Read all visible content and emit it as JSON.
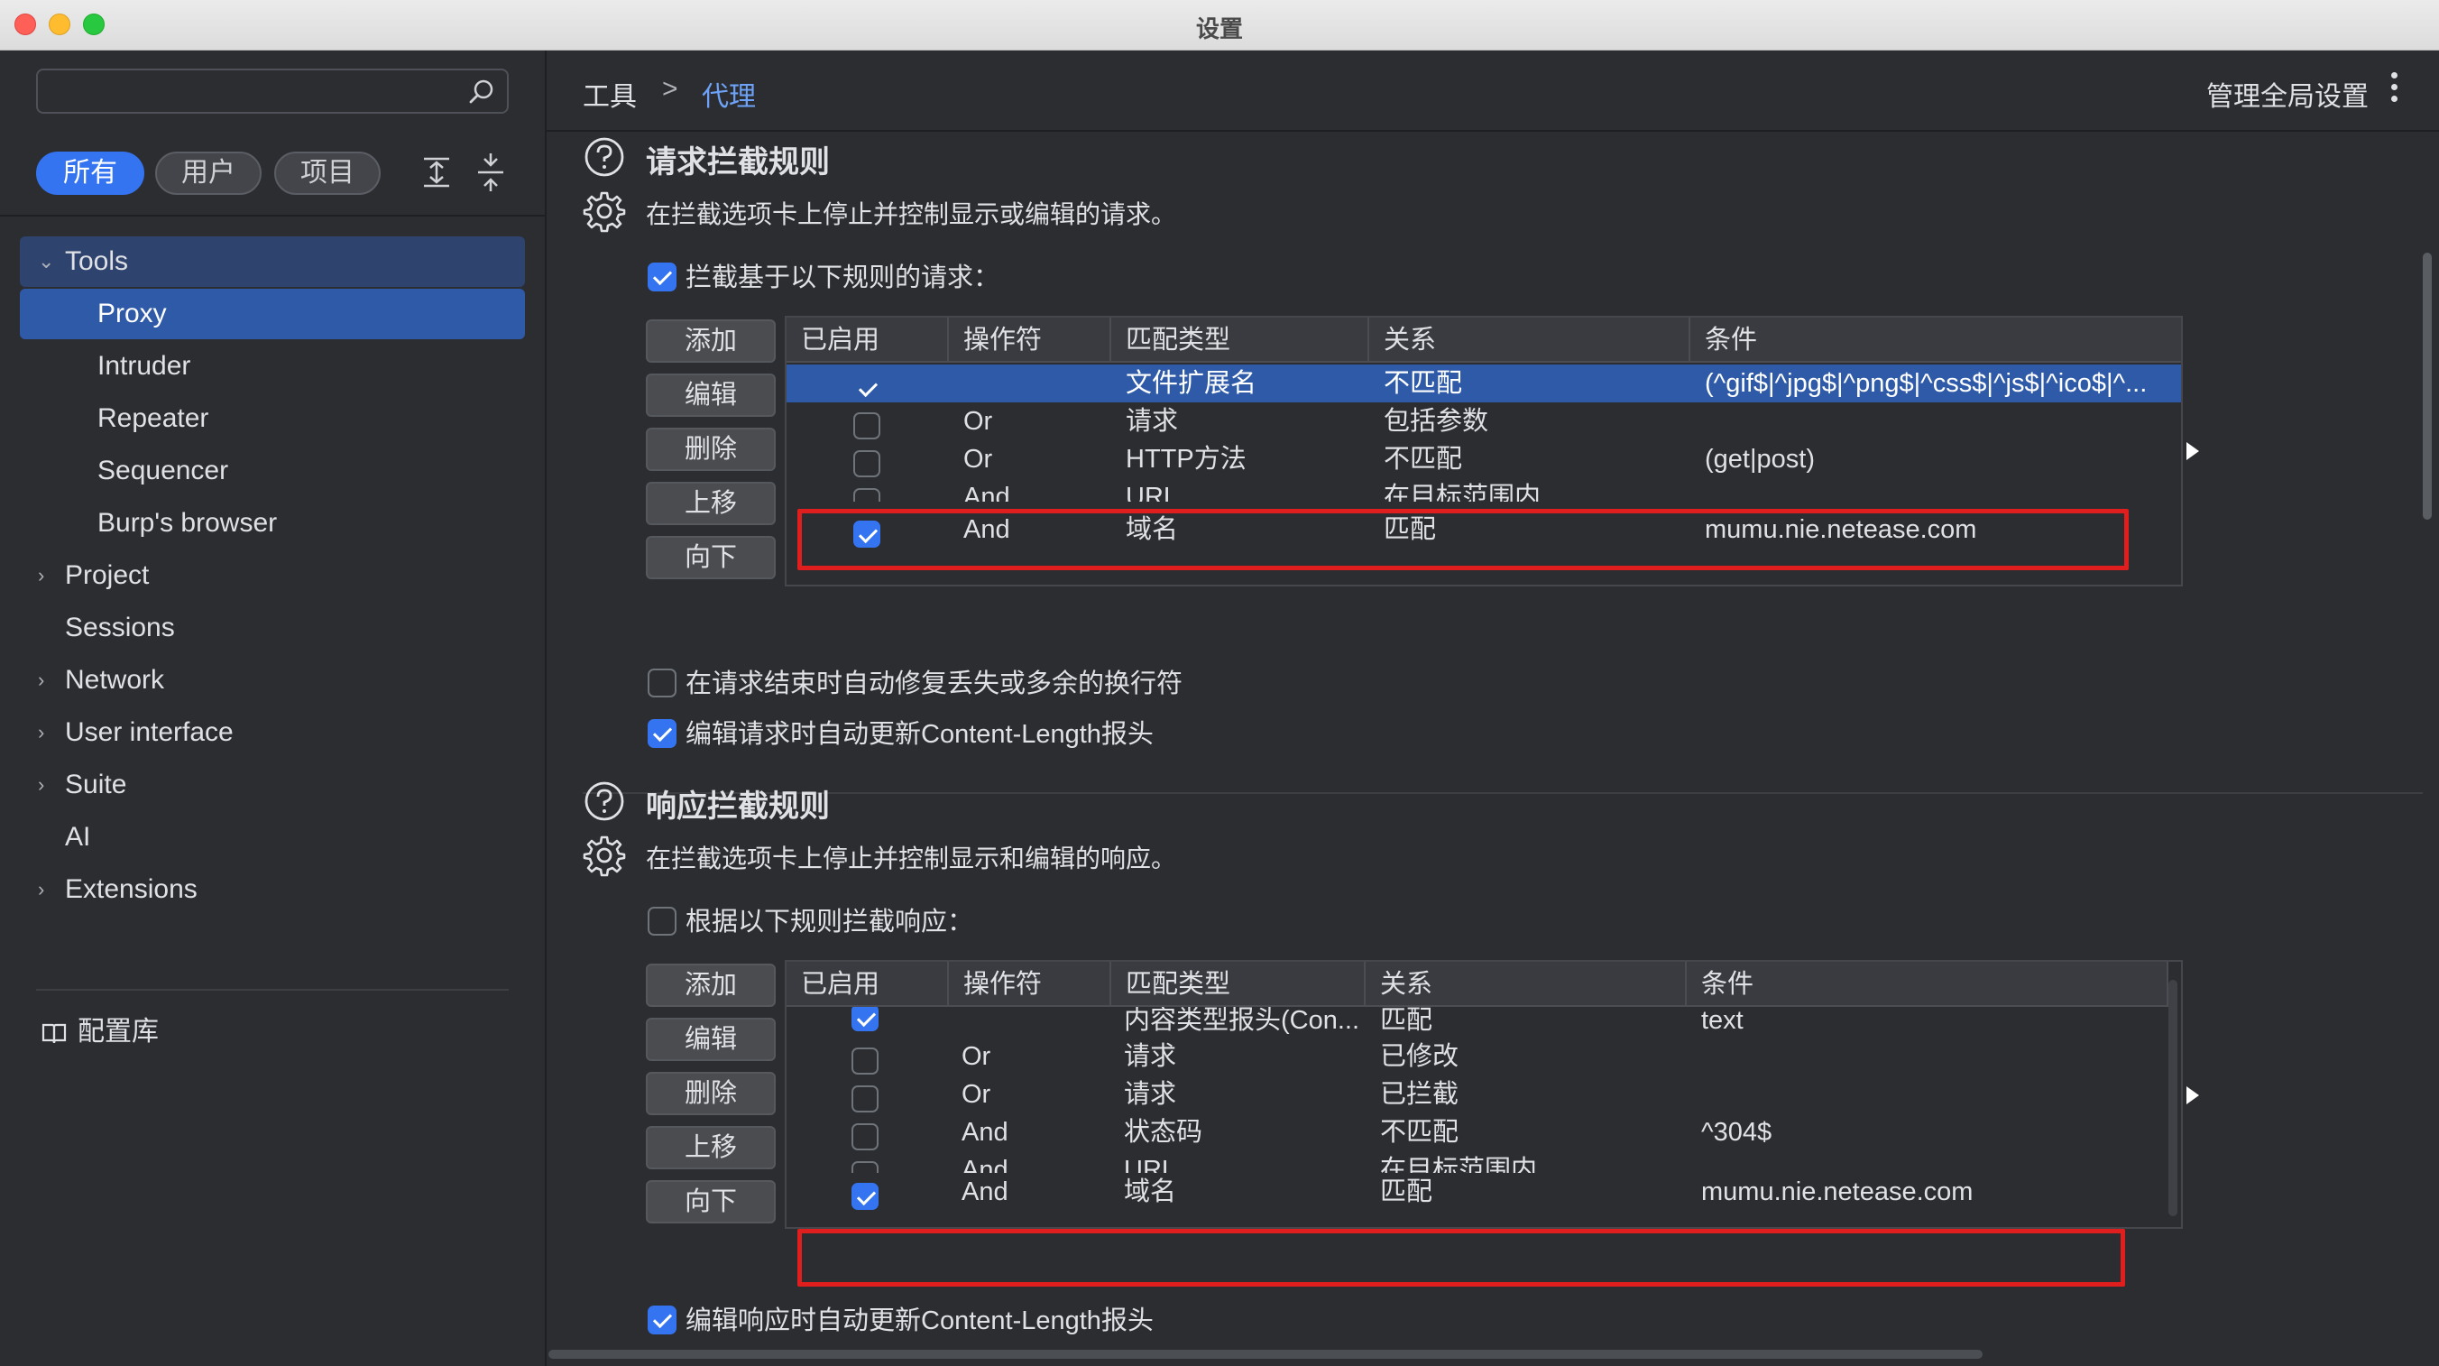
{
  "window": {
    "title": "设置"
  },
  "sidebar": {
    "search": {
      "placeholder": ""
    },
    "filters": [
      {
        "label": "所有",
        "active": true
      },
      {
        "label": "用户",
        "active": false
      },
      {
        "label": "项目",
        "active": false
      }
    ],
    "nav": [
      {
        "label": "Tools",
        "expanded": true
      },
      {
        "label": "Proxy",
        "selected": true
      },
      {
        "label": "Intruder"
      },
      {
        "label": "Repeater"
      },
      {
        "label": "Sequencer"
      },
      {
        "label": "Burp's browser"
      },
      {
        "label": "Project",
        "expandable": true
      },
      {
        "label": "Sessions"
      },
      {
        "label": "Network",
        "expandable": true
      },
      {
        "label": "User interface",
        "expandable": true
      },
      {
        "label": "Suite",
        "expandable": true
      },
      {
        "label": "AI"
      },
      {
        "label": "Extensions",
        "expandable": true
      }
    ],
    "library": {
      "label": "配置库"
    }
  },
  "header": {
    "breadcrumb": [
      "工具",
      ">",
      "代理"
    ],
    "manage_label": "管理全局设置"
  },
  "request_rules": {
    "title": "请求拦截规则",
    "description": "在拦截选项卡上停止并控制显示或编辑的请求。",
    "intercept_checkbox": {
      "label": "拦截基于以下规则的请求：",
      "checked": true
    },
    "buttons": [
      "添加",
      "编辑",
      "删除",
      "上移",
      "向下"
    ],
    "columns": [
      "已启用",
      "操作符",
      "匹配类型",
      "关系",
      "条件"
    ],
    "rows": [
      {
        "enabled": true,
        "operator": "",
        "match_type": "文件扩展名",
        "relationship": "不匹配",
        "condition": "(^gif$|^jpg$|^png$|^css$|^js$|^ico$|^...",
        "selected": true
      },
      {
        "enabled": false,
        "operator": "Or",
        "match_type": "请求",
        "relationship": "包括参数",
        "condition": ""
      },
      {
        "enabled": false,
        "operator": "Or",
        "match_type": "HTTP方法",
        "relationship": "不匹配",
        "condition": "(get|post)"
      },
      {
        "enabled": false,
        "operator": "And",
        "match_type": "URL",
        "relationship": "在目标范围内",
        "condition": ""
      },
      {
        "enabled": true,
        "operator": "And",
        "match_type": "域名",
        "relationship": "匹配",
        "condition": "mumu.nie.netease.com",
        "highlighted": true
      }
    ],
    "option_fix_newlines": {
      "label": "在请求结束时自动修复丢失或多余的换行符",
      "checked": false
    },
    "option_update_length": {
      "label": "编辑请求时自动更新Content-Length报头",
      "checked": true
    }
  },
  "response_rules": {
    "title": "响应拦截规则",
    "description": "在拦截选项卡上停止并控制显示和编辑的响应。",
    "intercept_checkbox": {
      "label": "根据以下规则拦截响应：",
      "checked": false
    },
    "buttons": [
      "添加",
      "编辑",
      "删除",
      "上移",
      "向下"
    ],
    "columns": [
      "已启用",
      "操作符",
      "匹配类型",
      "关系",
      "条件"
    ],
    "rows": [
      {
        "enabled": true,
        "operator": "",
        "match_type": "内容类型报头(Con...",
        "relationship": "匹配",
        "condition": "text"
      },
      {
        "enabled": false,
        "operator": "Or",
        "match_type": "请求",
        "relationship": "已修改",
        "condition": ""
      },
      {
        "enabled": false,
        "operator": "Or",
        "match_type": "请求",
        "relationship": "已拦截",
        "condition": ""
      },
      {
        "enabled": false,
        "operator": "And",
        "match_type": "状态码",
        "relationship": "不匹配",
        "condition": "^304$"
      },
      {
        "enabled": false,
        "operator": "And",
        "match_type": "URL",
        "relationship": "在目标范围内",
        "condition": ""
      },
      {
        "enabled": true,
        "operator": "And",
        "match_type": "域名",
        "relationship": "匹配",
        "condition": "mumu.nie.netease.com",
        "highlighted": true
      }
    ],
    "option_update_length": {
      "label": "编辑响应时自动更新Content-Length报头",
      "checked": true
    }
  },
  "colors": {
    "accent": "#3574f0",
    "selection": "#2e5aa8",
    "highlight_box": "#e01e1e",
    "breadcrumb_active": "#6ea2f7"
  },
  "icons": [
    "search-icon",
    "expand-all-icon",
    "collapse-all-icon",
    "help-icon",
    "gear-icon",
    "book-icon",
    "kebab-menu-icon"
  ]
}
